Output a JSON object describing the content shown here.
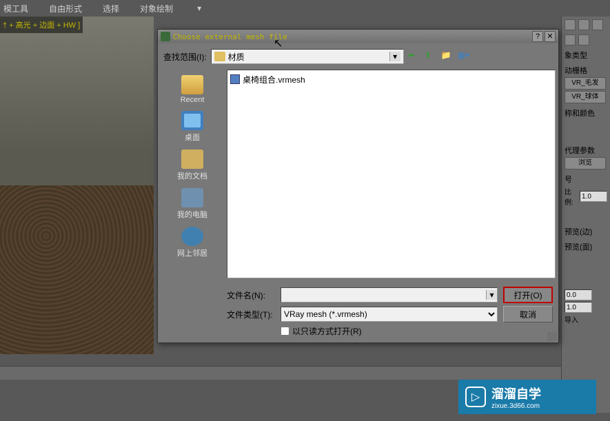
{
  "menu": {
    "tools": "模工具",
    "freeform": "自由形式",
    "select": "选择",
    "objdraw": "对象绘制"
  },
  "viewport_label": "† + 高光 + 边面 + HW ]",
  "dialog": {
    "title": "Choose external mesh file",
    "lookup_label": "查找范围(I):",
    "lookup_value": "材质",
    "sidebar": {
      "recent": "Recent",
      "desktop": "桌面",
      "mydocs": "我的文档",
      "computer": "我的电脑",
      "network": "网上邻居"
    },
    "file": {
      "name": "桌椅组合.vrmesh"
    },
    "filename_label": "文件名(N):",
    "filetype_label": "文件类型(T):",
    "filetype_value": "VRay mesh (*.vrmesh)",
    "readonly_label": "以只读方式打开(R)",
    "open": "打开(O)",
    "cancel": "取消"
  },
  "panel": {
    "object_type": "象类型",
    "auto_grid": "动栅格",
    "vr_fur": "VR_毛发",
    "vr_sphere": "VR_球体",
    "name_color": "称和颜色",
    "proxy_params": "代理参数",
    "browse": "浏览",
    "unit": "号",
    "ratio": "比例:",
    "ratio_val": "1.0",
    "preview_edge": "预览(边)",
    "preview_face": "预览(面)",
    "num1": "0.0",
    "num2": "1.0",
    "import": "导入"
  },
  "watermark": {
    "main": "溜溜自学",
    "sub": "zixue.3d66.com"
  }
}
